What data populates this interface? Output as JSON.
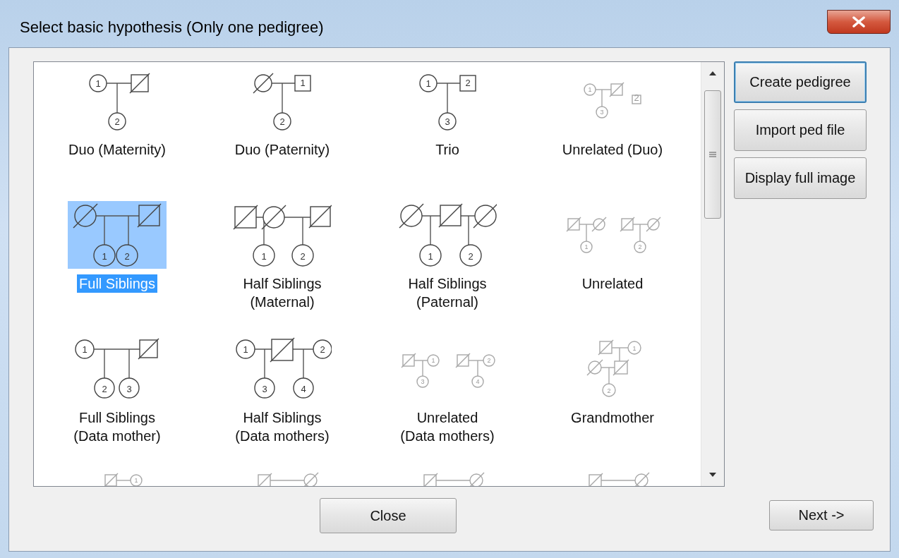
{
  "window": {
    "title": "Select basic hypothesis (Only one pedigree)"
  },
  "hypotheses": [
    {
      "kind": "duo-maternity",
      "label": [
        "Duo (Maternity)"
      ],
      "numbers": [
        "1",
        "2"
      ],
      "selected": false
    },
    {
      "kind": "duo-paternity",
      "label": [
        "Duo (Paternity)"
      ],
      "numbers": [
        "1",
        "2"
      ],
      "selected": false
    },
    {
      "kind": "trio",
      "label": [
        "Trio"
      ],
      "numbers": [
        "1",
        "2",
        "3"
      ],
      "selected": false
    },
    {
      "kind": "unrelated-duo",
      "label": [
        "Unrelated (Duo)"
      ],
      "numbers": [
        "1",
        "3",
        "2"
      ],
      "selected": false
    },
    {
      "kind": "full-siblings",
      "label": [
        "Full Siblings"
      ],
      "numbers": [
        "1",
        "2"
      ],
      "selected": true
    },
    {
      "kind": "half-maternal",
      "label": [
        "Half Siblings",
        "(Maternal)"
      ],
      "numbers": [
        "1",
        "2"
      ],
      "selected": false
    },
    {
      "kind": "half-paternal",
      "label": [
        "Half Siblings",
        "(Paternal)"
      ],
      "numbers": [
        "1",
        "2"
      ],
      "selected": false
    },
    {
      "kind": "unrelated",
      "label": [
        "Unrelated"
      ],
      "numbers": [
        "1",
        "2"
      ],
      "selected": false
    },
    {
      "kind": "full-data-mother",
      "label": [
        "Full Siblings",
        "(Data mother)"
      ],
      "numbers": [
        "1",
        "2",
        "3"
      ],
      "selected": false
    },
    {
      "kind": "half-data-mothers",
      "label": [
        "Half Siblings",
        "(Data mothers)"
      ],
      "numbers": [
        "1",
        "2",
        "3",
        "4"
      ],
      "selected": false
    },
    {
      "kind": "unrelated-data-mothers",
      "label": [
        "Unrelated",
        "(Data mothers)"
      ],
      "numbers": [
        "1",
        "3",
        "2",
        "4"
      ],
      "selected": false
    },
    {
      "kind": "grandmother",
      "label": [
        "Grandmother"
      ],
      "numbers": [
        "1",
        "2"
      ],
      "selected": false
    },
    {
      "kind": "cut-a",
      "numbers": [
        "1"
      ],
      "selected": false
    },
    {
      "kind": "cut-b",
      "selected": false
    },
    {
      "kind": "cut-c",
      "selected": false
    },
    {
      "kind": "cut-d",
      "selected": false
    }
  ],
  "side_buttons": [
    {
      "label": "Create pedigree",
      "focused": true
    },
    {
      "label": "Import ped file",
      "focused": false
    },
    {
      "label": "Display full image",
      "focused": false
    }
  ],
  "footer": {
    "close": "Close",
    "next": "Next ->"
  }
}
